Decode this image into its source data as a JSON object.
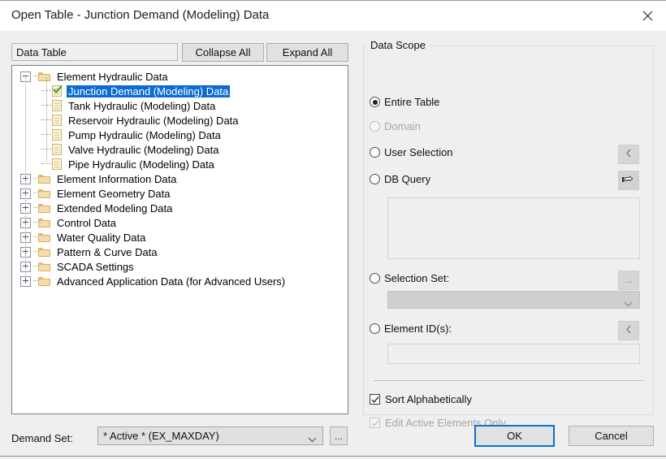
{
  "window": {
    "title": "Open Table - Junction Demand (Modeling) Data",
    "close_icon": "close-icon"
  },
  "left_panel": {
    "data_table_label": "Data Table",
    "collapse_all_label": "Collapse All",
    "expand_all_label": "Expand All",
    "tree": [
      {
        "label": "Element Hydraulic Data",
        "type": "folder",
        "expanded": true,
        "level": 1,
        "selected": false,
        "checked": false
      },
      {
        "label": "Junction Demand (Modeling) Data",
        "type": "doc",
        "level": 2,
        "selected": true,
        "checked": true
      },
      {
        "label": "Tank Hydraulic (Modeling) Data",
        "type": "doc",
        "level": 2,
        "selected": false,
        "checked": false
      },
      {
        "label": "Reservoir Hydraulic (Modeling) Data",
        "type": "doc",
        "level": 2,
        "selected": false,
        "checked": false
      },
      {
        "label": "Pump Hydraulic (Modeling) Data",
        "type": "doc",
        "level": 2,
        "selected": false,
        "checked": false
      },
      {
        "label": "Valve Hydraulic (Modeling) Data",
        "type": "doc",
        "level": 2,
        "selected": false,
        "checked": false
      },
      {
        "label": "Pipe Hydraulic (Modeling) Data",
        "type": "doc",
        "level": 2,
        "selected": false,
        "checked": false
      },
      {
        "label": "Element Information Data",
        "type": "folder",
        "expanded": false,
        "level": 1,
        "selected": false,
        "checked": false
      },
      {
        "label": "Element Geometry Data",
        "type": "folder",
        "expanded": false,
        "level": 1,
        "selected": false,
        "checked": false
      },
      {
        "label": "Extended Modeling Data",
        "type": "folder",
        "expanded": false,
        "level": 1,
        "selected": false,
        "checked": false
      },
      {
        "label": "Control Data",
        "type": "folder",
        "expanded": false,
        "level": 1,
        "selected": false,
        "checked": false
      },
      {
        "label": "Water Quality Data",
        "type": "folder",
        "expanded": false,
        "level": 1,
        "selected": false,
        "checked": false
      },
      {
        "label": "Pattern & Curve Data",
        "type": "folder",
        "expanded": false,
        "level": 1,
        "selected": false,
        "checked": false
      },
      {
        "label": "SCADA Settings",
        "type": "folder",
        "expanded": false,
        "level": 1,
        "selected": false,
        "checked": false
      },
      {
        "label": "Advanced Application Data (for Advanced Users)",
        "type": "folder",
        "expanded": false,
        "level": 1,
        "selected": false,
        "checked": false
      }
    ]
  },
  "demand_set": {
    "label": "Demand Set:",
    "value": "* Active * (EX_MAXDAY)",
    "ellipsis_label": "...",
    "dropdown_icon": "chevron-down-icon"
  },
  "data_scope": {
    "legend": "Data Scope",
    "options": [
      {
        "label": "Entire Table",
        "selected": true,
        "disabled": false
      },
      {
        "label": "Domain",
        "selected": false,
        "disabled": true
      },
      {
        "label": "User Selection",
        "selected": false,
        "disabled": false
      },
      {
        "label": "DB Query",
        "selected": false,
        "disabled": false
      },
      {
        "label": "Selection Set:",
        "selected": false,
        "disabled": false
      },
      {
        "label": "Element ID(s):",
        "selected": false,
        "disabled": false
      }
    ],
    "user_selection_button_icon": "left-chevron-icon",
    "db_query_button_icon": "pointing-hand-icon",
    "selection_set_button_label": "...",
    "element_id_button_icon": "left-chevron-icon",
    "db_query_text": "",
    "selection_set_value": "",
    "element_id_value": "",
    "checkboxes": [
      {
        "label": "Sort Alphabetically",
        "checked": true,
        "disabled": false
      },
      {
        "label": "Edit Active Elements Only",
        "checked": true,
        "disabled": true
      }
    ]
  },
  "footer": {
    "ok_label": "OK",
    "cancel_label": "Cancel",
    "accent_color": "#0a72d0"
  }
}
